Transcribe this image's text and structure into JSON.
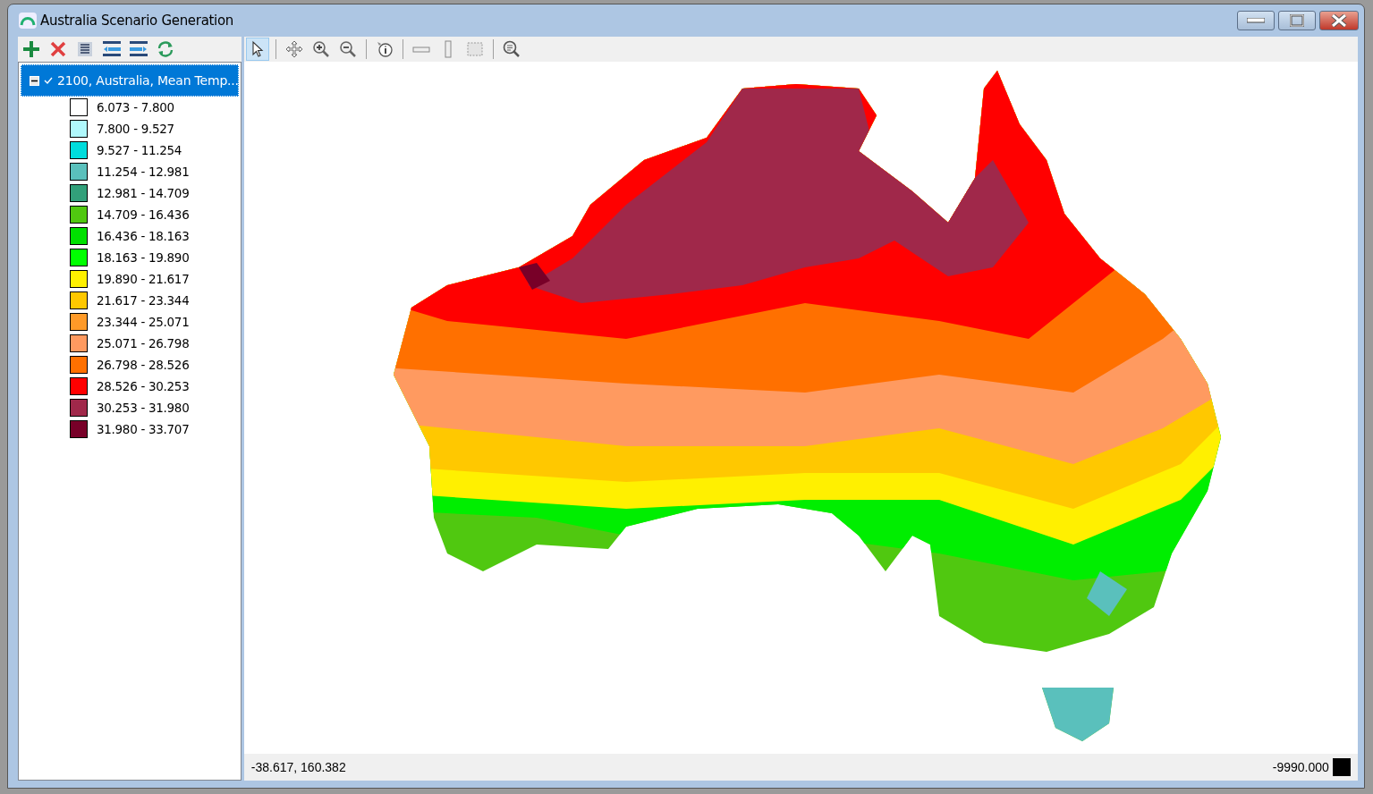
{
  "window": {
    "title": "Australia Scenario Generation"
  },
  "map_tools": [
    {
      "kind": "pointer",
      "selected": true
    },
    {
      "kind": "pan",
      "selected": false
    },
    {
      "kind": "zoomin",
      "selected": false
    },
    {
      "kind": "zoomout",
      "selected": false
    },
    {
      "kind": "info",
      "selected": false
    },
    {
      "kind": "hruler",
      "selected": false
    },
    {
      "kind": "vruler",
      "selected": false
    },
    {
      "kind": "select",
      "selected": false
    },
    {
      "kind": "zoomsearch",
      "selected": false
    }
  ],
  "layer": {
    "label": "2100, Australia, Mean Temp...",
    "expanded": true,
    "checked": true,
    "selected": true
  },
  "legend": [
    {
      "label": "6.073 - 7.800",
      "color": "#ffffff"
    },
    {
      "label": "7.800 - 9.527",
      "color": "#b0f8fc"
    },
    {
      "label": "9.527 - 11.254",
      "color": "#00dcdc"
    },
    {
      "label": "11.254 - 12.981",
      "color": "#5ac0bc"
    },
    {
      "label": "12.981 - 14.709",
      "color": "#32a07a"
    },
    {
      "label": "14.709 - 16.436",
      "color": "#50c810"
    },
    {
      "label": "16.436 - 18.163",
      "color": "#00e000"
    },
    {
      "label": "18.163 - 19.890",
      "color": "#00ff00"
    },
    {
      "label": "19.890 - 21.617",
      "color": "#fff000"
    },
    {
      "label": "21.617 - 23.344",
      "color": "#ffc800"
    },
    {
      "label": "23.344 - 25.071",
      "color": "#ff9a28"
    },
    {
      "label": "25.071 - 26.798",
      "color": "#ff9a60"
    },
    {
      "label": "26.798 - 28.526",
      "color": "#ff7000"
    },
    {
      "label": "28.526 - 30.253",
      "color": "#ff0000"
    },
    {
      "label": "30.253 - 31.980",
      "color": "#a0284a"
    },
    {
      "label": "31.980 - 33.707",
      "color": "#780028"
    }
  ],
  "status_bar": {
    "coordinates": "-38.617, 160.382",
    "value": "-9990.000"
  }
}
